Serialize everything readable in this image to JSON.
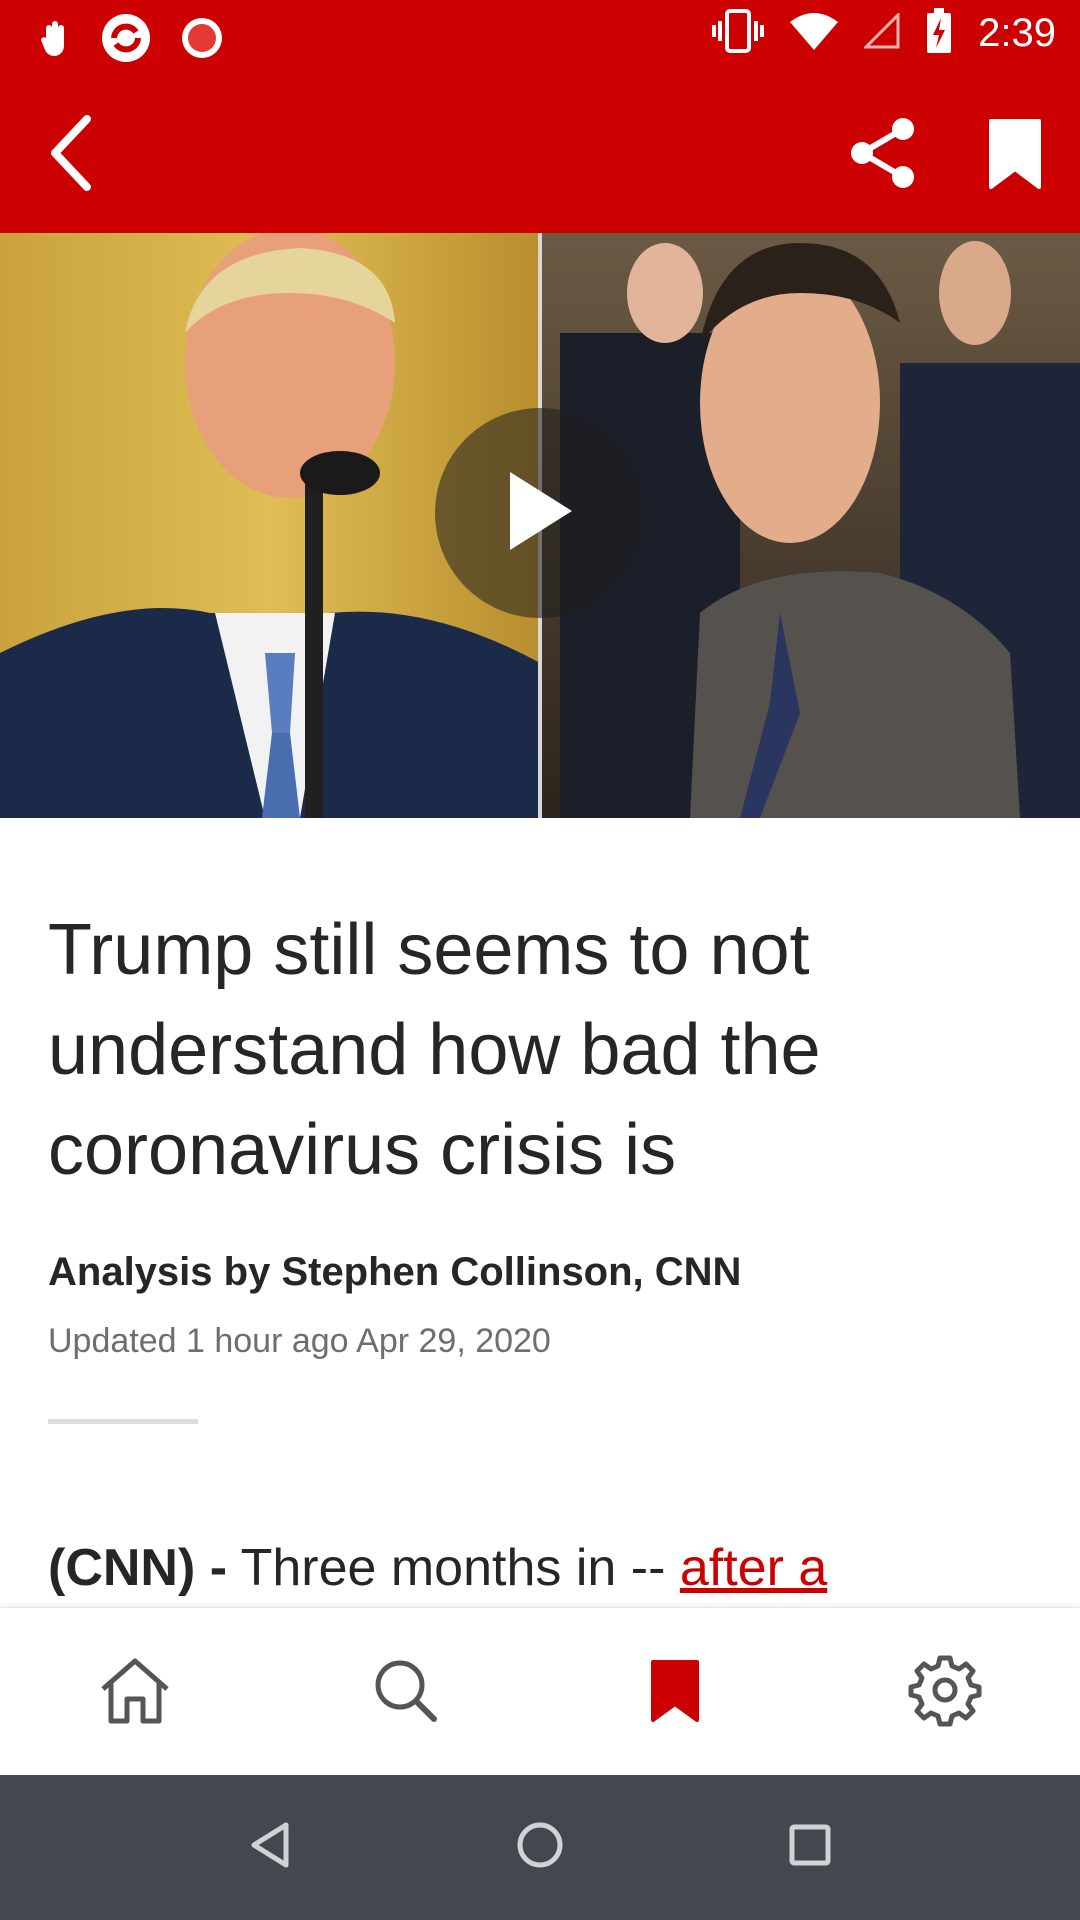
{
  "status_bar": {
    "time": "2:39",
    "icons": [
      "gesture-icon",
      "app-sync-icon",
      "record-icon",
      "vibrate-icon",
      "wifi-icon",
      "signal-icon",
      "battery-charging-icon"
    ]
  },
  "app_bar": {
    "back_icon": "back-arrow-icon",
    "share_icon": "share-icon",
    "bookmark_icon": "bookmark-icon"
  },
  "video": {
    "play_icon": "play-icon"
  },
  "article": {
    "headline": "Trump still seems to not understand how bad the coronavirus crisis is",
    "byline": "Analysis by Stephen Collinson, CNN",
    "updated": "Updated 1 hour ago Apr 29, 2020",
    "lede_source": "(CNN) -",
    "lede_text": " Three months in -- ",
    "lede_link": "after a"
  },
  "bottom_tabs": [
    {
      "name": "home",
      "icon": "home-icon",
      "active": false
    },
    {
      "name": "search",
      "icon": "search-icon",
      "active": false
    },
    {
      "name": "saved",
      "icon": "bookmark-icon",
      "active": true
    },
    {
      "name": "settings",
      "icon": "gear-icon",
      "active": false
    }
  ],
  "colors": {
    "brand": "#cc0000",
    "nav_bar": "#42484e",
    "text": "#262626",
    "muted": "#6e6e6e"
  }
}
